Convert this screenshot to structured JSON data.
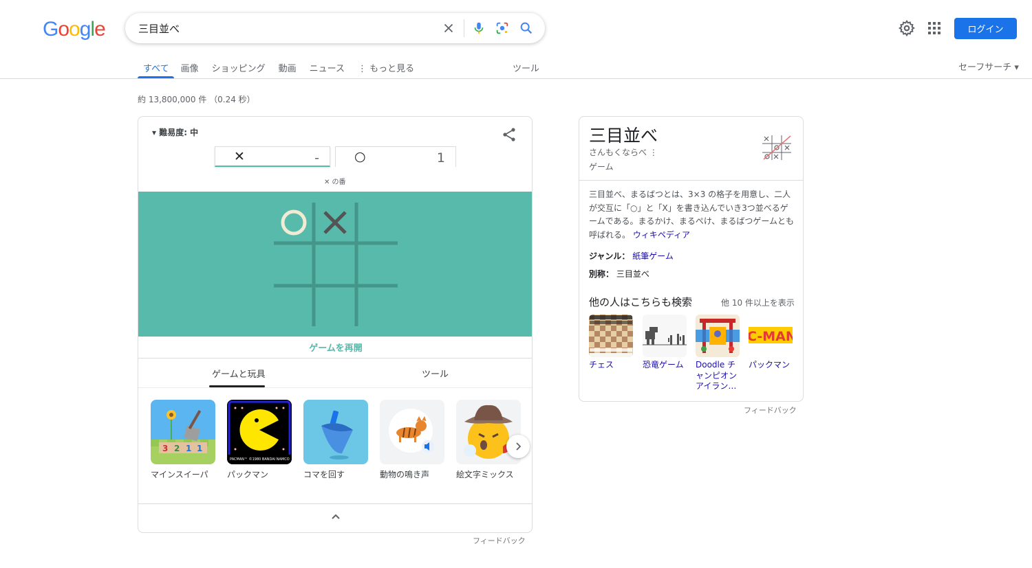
{
  "logo": "Google",
  "search": {
    "query": "三目並べ"
  },
  "header": {
    "login_label": "ログイン"
  },
  "tabs": [
    {
      "label": "すべて",
      "active": true
    },
    {
      "label": "画像"
    },
    {
      "label": "ショッピング"
    },
    {
      "label": "動画"
    },
    {
      "label": "ニュース"
    },
    {
      "label": "⋮ もっと見る"
    }
  ],
  "tools_label": "ツール",
  "safesearch_label": "セーフサーチ ▾",
  "result_stats": "約 13,800,000 件 （0.24 秒）",
  "game": {
    "difficulty": "▾  難易度: 中",
    "score_x": {
      "mark": "✕",
      "value": "-"
    },
    "score_o": {
      "mark": "○",
      "value": "1"
    },
    "turn_text": "✕ の番",
    "board": [
      "O",
      "X",
      "",
      "",
      "",
      "",
      "",
      "",
      ""
    ],
    "board_color": "#58baab",
    "replay_label": "ゲームを再開",
    "subtabs": [
      "ゲームと玩具",
      "ツール"
    ],
    "items": [
      {
        "label": "マインスイーパ",
        "icon": "minesweeper-icon"
      },
      {
        "label": "パックマン",
        "icon": "pacman-icon"
      },
      {
        "label": "コマを回す",
        "icon": "spinning-top-icon"
      },
      {
        "label": "動物の鳴き声",
        "icon": "animal-sounds-icon"
      },
      {
        "label": "絵文字ミックス",
        "icon": "emoji-kitchen-icon"
      }
    ],
    "minesweeper_digits": [
      "3",
      "2",
      "1",
      "1"
    ],
    "pacman_caption": "PACMAN™ ©1980 BANDAI NAMCO",
    "feedback": "フィードバック"
  },
  "knowledge_panel": {
    "title": "三目並べ",
    "reading": "さんもくならべ ⋮",
    "type": "ゲーム",
    "description": "三目並べ、まるばつとは、3×3 の格子を用意し、二人が交互に「○」と「X」を書き込んでいき3つ並べるゲームである。まるかけ、まるぺけ、まるばつゲームとも呼ばれる。",
    "wiki_link": "ウィキペディア",
    "genre_label": "ジャンル：",
    "genre_value": "紙筆ゲーム",
    "alias_label": "別称：",
    "alias_value": "三目並べ",
    "also_search_title": "他の人はこちらも検索",
    "more_label": "他 10 件以上を表示",
    "related": [
      {
        "label": "チェス",
        "icon": "chess-icon"
      },
      {
        "label": "恐竜ゲーム",
        "icon": "dino-game-icon"
      },
      {
        "label": "Doodle チャンピオン アイラン…",
        "icon": "doodle-champion-island-icon"
      },
      {
        "label": "パックマン",
        "icon": "pacman-icon"
      }
    ],
    "related_pacman_text": "C-MAN",
    "feedback": "フィードバック"
  }
}
